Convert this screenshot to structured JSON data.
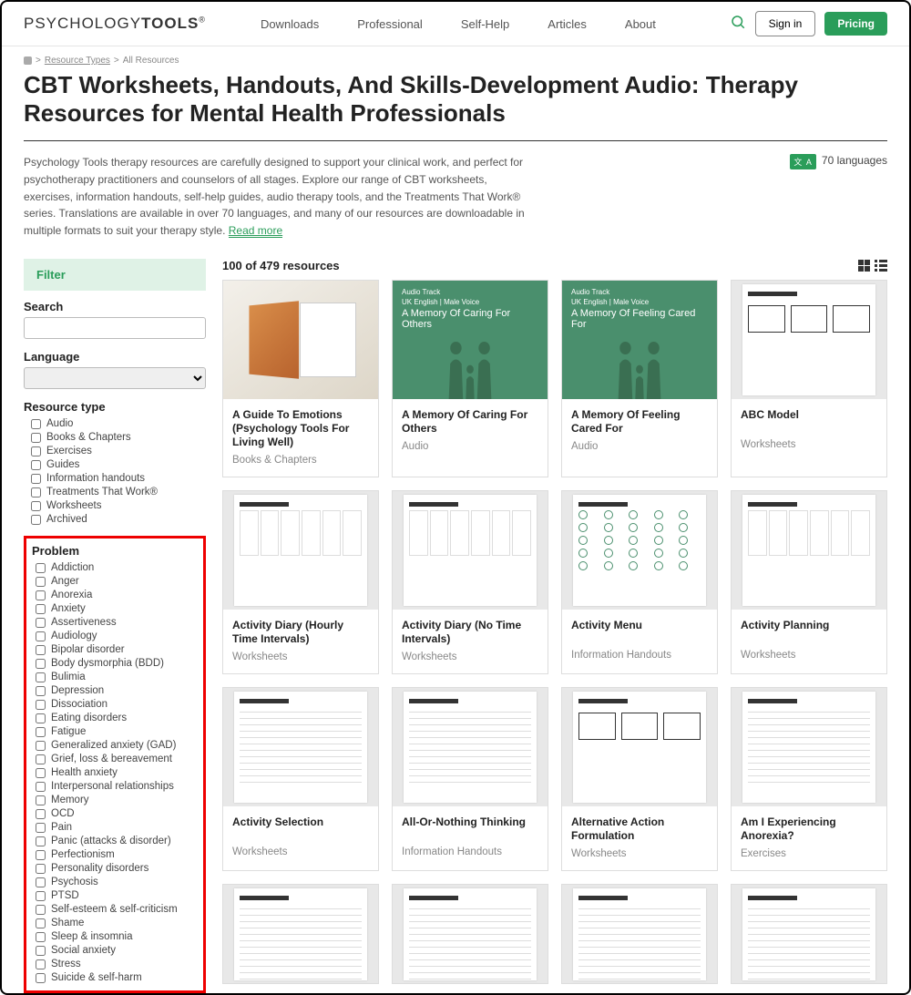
{
  "header": {
    "logo_a": "PSYCHOLOGY",
    "logo_b": "TOOLS",
    "logo_r": "®",
    "nav": [
      "Downloads",
      "Professional",
      "Self-Help",
      "Articles",
      "About"
    ],
    "signin": "Sign in",
    "pricing": "Pricing"
  },
  "breadcrumb": {
    "a": "Resource Types",
    "b": "All Resources"
  },
  "title": "CBT Worksheets, Handouts, And Skills-Development Audio: Therapy Resources for Mental Health Professionals",
  "intro": "Psychology Tools therapy resources are carefully designed to support your clinical work, and perfect for psychotherapy practitioners and counselors of all stages. Explore our range of CBT worksheets, exercises, information handouts, self-help guides, audio therapy tools, and the Treatments That Work® series. Translations are available in over 70 languages, and many of our resources are downloadable in multiple formats to suit your therapy style.",
  "readmore": "Read more",
  "lang_badge": {
    "icon": "文 A",
    "text": "70 languages"
  },
  "filter": {
    "heading": "Filter",
    "search_label": "Search",
    "search_value": "",
    "language_label": "Language",
    "language_value": "",
    "type_label": "Resource type",
    "types": [
      "Audio",
      "Books & Chapters",
      "Exercises",
      "Guides",
      "Information handouts",
      "Treatments That Work®",
      "Worksheets",
      "Archived"
    ],
    "problem_label": "Problem",
    "problems": [
      "Addiction",
      "Anger",
      "Anorexia",
      "Anxiety",
      "Assertiveness",
      "Audiology",
      "Bipolar disorder",
      "Body dysmorphia (BDD)",
      "Bulimia",
      "Depression",
      "Dissociation",
      "Eating disorders",
      "Fatigue",
      "Generalized anxiety (GAD)",
      "Grief, loss & bereavement",
      "Health anxiety",
      "Interpersonal relationships",
      "Memory",
      "OCD",
      "Pain",
      "Panic (attacks & disorder)",
      "Perfectionism",
      "Personality disorders",
      "Psychosis",
      "PTSD",
      "Self-esteem & self-criticism",
      "Shame",
      "Sleep & insomnia",
      "Social anxiety",
      "Stress",
      "Suicide & self-harm"
    ]
  },
  "results": {
    "count_text": "100 of 479 resources",
    "cards": [
      {
        "title": "A Guide To Emotions (Psychology Tools For Living Well)",
        "sub": "Books & Chapters",
        "thumb": "book",
        "atitle": ""
      },
      {
        "title": "A Memory Of Caring For Others",
        "sub": "Audio",
        "thumb": "audio",
        "atitle": "A Memory Of Caring For Others"
      },
      {
        "title": "A Memory Of Feeling Cared For",
        "sub": "Audio",
        "thumb": "audio",
        "atitle": "A Memory Of Feeling Cared For"
      },
      {
        "title": "ABC Model",
        "sub": "Worksheets",
        "thumb": "boxes",
        "atitle": ""
      },
      {
        "title": "Activity Diary (Hourly Time Intervals)",
        "sub": "Worksheets",
        "thumb": "grid",
        "atitle": ""
      },
      {
        "title": "Activity Diary (No Time Intervals)",
        "sub": "Worksheets",
        "thumb": "grid",
        "atitle": ""
      },
      {
        "title": "Activity Menu",
        "sub": "Information Handouts",
        "thumb": "dots",
        "atitle": ""
      },
      {
        "title": "Activity Planning",
        "sub": "Worksheets",
        "thumb": "grid",
        "atitle": ""
      },
      {
        "title": "Activity Selection",
        "sub": "Worksheets",
        "thumb": "lines",
        "atitle": ""
      },
      {
        "title": "All-Or-Nothing Thinking",
        "sub": "Information Handouts",
        "thumb": "lines",
        "atitle": ""
      },
      {
        "title": "Alternative Action Formulation",
        "sub": "Worksheets",
        "thumb": "boxes",
        "atitle": ""
      },
      {
        "title": "Am I Experiencing Anorexia?",
        "sub": "Exercises",
        "thumb": "lines",
        "atitle": ""
      },
      {
        "title": "",
        "sub": "",
        "thumb": "lines",
        "atitle": ""
      },
      {
        "title": "",
        "sub": "",
        "thumb": "lines",
        "atitle": ""
      },
      {
        "title": "",
        "sub": "",
        "thumb": "lines",
        "atitle": ""
      },
      {
        "title": "",
        "sub": "",
        "thumb": "lines",
        "atitle": ""
      }
    ]
  }
}
